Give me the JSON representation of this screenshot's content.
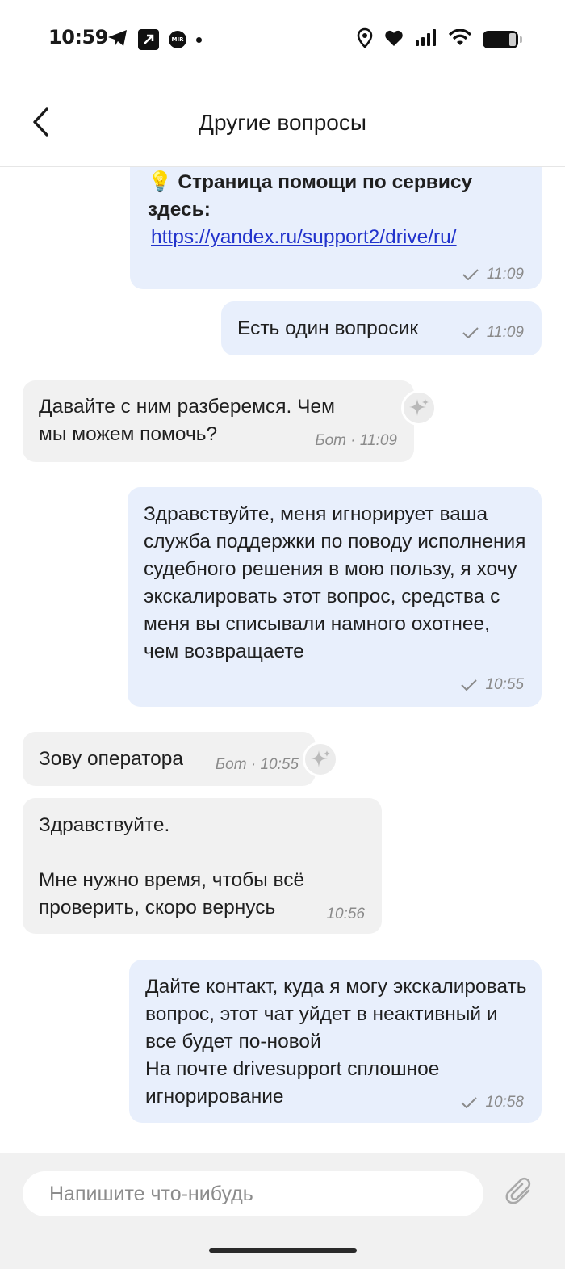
{
  "status_bar": {
    "time": "10:59",
    "left_icons": [
      "telegram-icon",
      "arrow-up-right-box-icon",
      "mir-icon",
      "dot-icon"
    ],
    "mir_label": "MIR",
    "right_icons": [
      "location-icon",
      "heart-icon",
      "signal-icon",
      "wifi-icon",
      "battery-icon"
    ]
  },
  "header": {
    "title": "Другие вопросы",
    "back_icon": "chevron-left-icon"
  },
  "messages": [
    {
      "direction": "outgoing",
      "emoji": "💡",
      "bold_text": "Страница помощи по сервису здесь:",
      "link": "https://yandex.ru/support2/drive/ru/",
      "time": "11:09",
      "read": true
    },
    {
      "direction": "outgoing",
      "text": "Есть один вопросик",
      "time": "11:09",
      "read": true
    },
    {
      "direction": "incoming",
      "text": "Давайте с ним разберемся. Чем мы можем помочь?",
      "meta": "Бот · 11:09",
      "bot": true
    },
    {
      "direction": "outgoing",
      "text": "Здравствуйте, меня игнорирует ваша служба поддержки по поводу исполнения судебного решения в мою пользу, я хочу экскалировать этот вопрос, средства с меня вы списывали намного охотнее, чем возвращаете",
      "time": "10:55",
      "read": true
    },
    {
      "direction": "incoming",
      "text": "Зову оператора",
      "meta": "Бот · 10:55",
      "bot": true
    },
    {
      "direction": "incoming",
      "text": "Здравствуйте.\n\nМне нужно время, чтобы всё проверить, скоро вернусь",
      "time": "10:56",
      "bot": false
    },
    {
      "direction": "outgoing",
      "text": "Дайте контакт, куда я могу экскалировать вопрос, этот чат уйдет в неактивный и все будет по-новой\nНа почте  drivesupport сплошное игнорирование",
      "time": "10:58",
      "read": true
    }
  ],
  "composer": {
    "placeholder": "Напишите что-нибудь",
    "attach_icon": "paperclip-icon"
  },
  "colors": {
    "outgoing_bubble": "#e8effc",
    "incoming_bubble": "#f1f1f1",
    "link": "#2233cc",
    "meta_text": "#8a8a8a"
  }
}
